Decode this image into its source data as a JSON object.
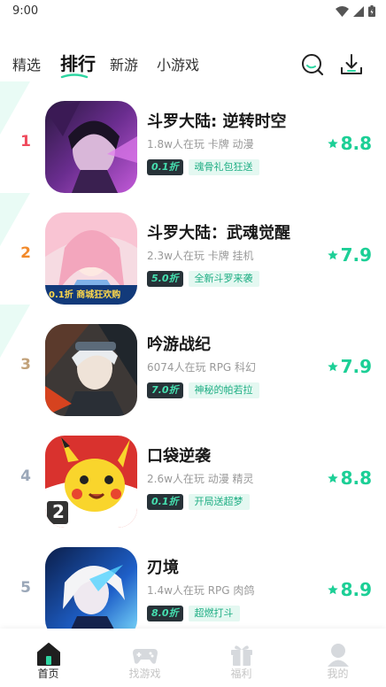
{
  "status_bar": {
    "time": "9:00"
  },
  "top_tabs": [
    {
      "label": "精选"
    },
    {
      "label": "排行"
    },
    {
      "label": "新游"
    },
    {
      "label": "小游戏"
    }
  ],
  "colors": {
    "accent": "#1ccf96",
    "discount_bg": "#273238",
    "promo_bg": "#e4f8f1",
    "rank1": "#ef4a5c",
    "rank2": "#f28a2b",
    "rank3": "#c2a27a",
    "rank_other": "#9aa7b8"
  },
  "games": [
    {
      "rank": "1",
      "title": "斗罗大陆: 逆转时空",
      "meta": "1.8w人在玩  卡牌  动漫",
      "discount": "0.1折",
      "promo": "魂骨礼包狂送",
      "score": "8.8"
    },
    {
      "rank": "2",
      "title": "斗罗大陆：武魂觉醒",
      "meta": "2.3w人在玩  卡牌  挂机",
      "discount": "5.0折",
      "promo": "全新斗罗来袭",
      "score": "7.9",
      "thumb_text": "0.1折 商城狂欢购"
    },
    {
      "rank": "3",
      "title": "吟游战纪",
      "meta": "6074人在玩  RPG  科幻",
      "discount": "7.0折",
      "promo": "神秘的帕若拉",
      "score": "7.9"
    },
    {
      "rank": "4",
      "title": "口袋逆袭",
      "meta": "2.6w人在玩  动漫  精灵",
      "discount": "0.1折",
      "promo": "开局送超梦",
      "score": "8.8",
      "thumb_text": "2"
    },
    {
      "rank": "5",
      "title": "刃境",
      "meta": "1.4w人在玩  RPG  肉鸽",
      "discount": "8.0折",
      "promo": "超燃打斗",
      "score": "8.9"
    }
  ],
  "bottom_nav": [
    {
      "label": "首页",
      "icon": "home-icon"
    },
    {
      "label": "找游戏",
      "icon": "gamepad-icon"
    },
    {
      "label": "福利",
      "icon": "gift-icon"
    },
    {
      "label": "我的",
      "icon": "user-icon"
    }
  ]
}
